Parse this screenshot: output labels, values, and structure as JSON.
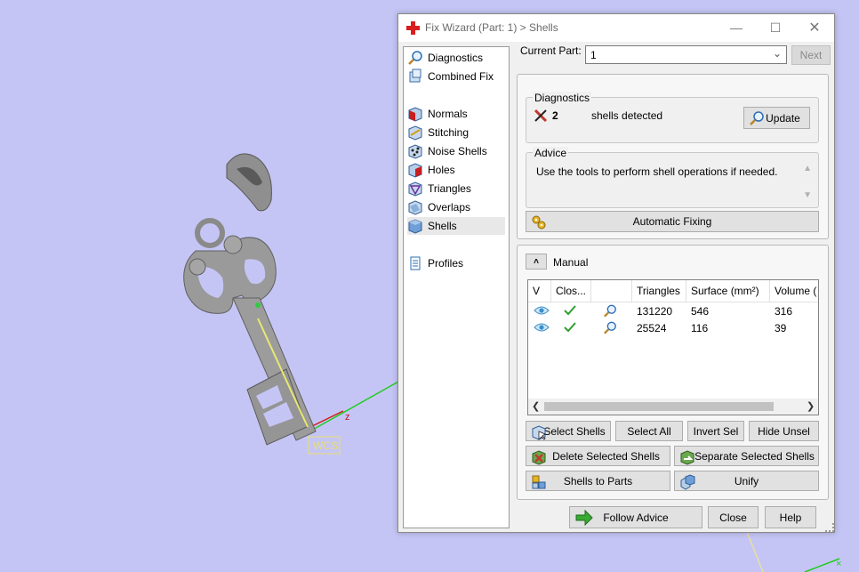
{
  "viewport": {
    "wcs_label": "WCS",
    "z_label": "z"
  },
  "window": {
    "title": "Fix Wizard (Part: 1) > Shells",
    "current_part_label": "Current Part:",
    "current_part_value": "1",
    "next_label": "Next"
  },
  "sidebar": {
    "items": [
      {
        "label": "Diagnostics",
        "icon": "magnifier-icon"
      },
      {
        "label": "Combined Fix",
        "icon": "combined-fix-icon"
      },
      {
        "label": "Normals",
        "icon": "normals-icon"
      },
      {
        "label": "Stitching",
        "icon": "stitching-icon"
      },
      {
        "label": "Noise Shells",
        "icon": "noise-shells-icon"
      },
      {
        "label": "Holes",
        "icon": "holes-icon"
      },
      {
        "label": "Triangles",
        "icon": "triangles-icon"
      },
      {
        "label": "Overlaps",
        "icon": "overlaps-icon"
      },
      {
        "label": "Shells",
        "icon": "shells-icon",
        "selected": true
      },
      {
        "label": "Profiles",
        "icon": "profiles-icon"
      }
    ]
  },
  "diagnostics": {
    "title": "Diagnostics",
    "count": "2",
    "text": "shells detected",
    "update_label": "Update"
  },
  "advice": {
    "title": "Advice",
    "text": "Use the tools to perform shell operations if needed."
  },
  "automatic_fixing_label": "Automatic Fixing",
  "manual": {
    "label": "Manual",
    "columns": [
      "V",
      "Clos...",
      "",
      "Triangles",
      "Surface (mm²)",
      "Volume ("
    ],
    "rows": [
      {
        "triangles": "131220",
        "surface": "546",
        "volume": "316"
      },
      {
        "triangles": "25524",
        "surface": "116",
        "volume": "39"
      }
    ],
    "buttons": {
      "select_shells": "Select Shells",
      "select_all": "Select All",
      "invert_sel": "Invert Sel",
      "hide_unsel": "Hide Unsel",
      "delete_selected": "Delete Selected Shells",
      "separate_selected": "Separate Selected Shells",
      "shells_to_parts": "Shells to Parts",
      "unify": "Unify"
    }
  },
  "footer": {
    "follow_advice": "Follow Advice",
    "close": "Close",
    "help": "Help"
  },
  "colors": {
    "background": "#c5c5f5",
    "error_x": "#c0392b",
    "check": "#2e9e2e",
    "eye": "#3a8fc9"
  }
}
